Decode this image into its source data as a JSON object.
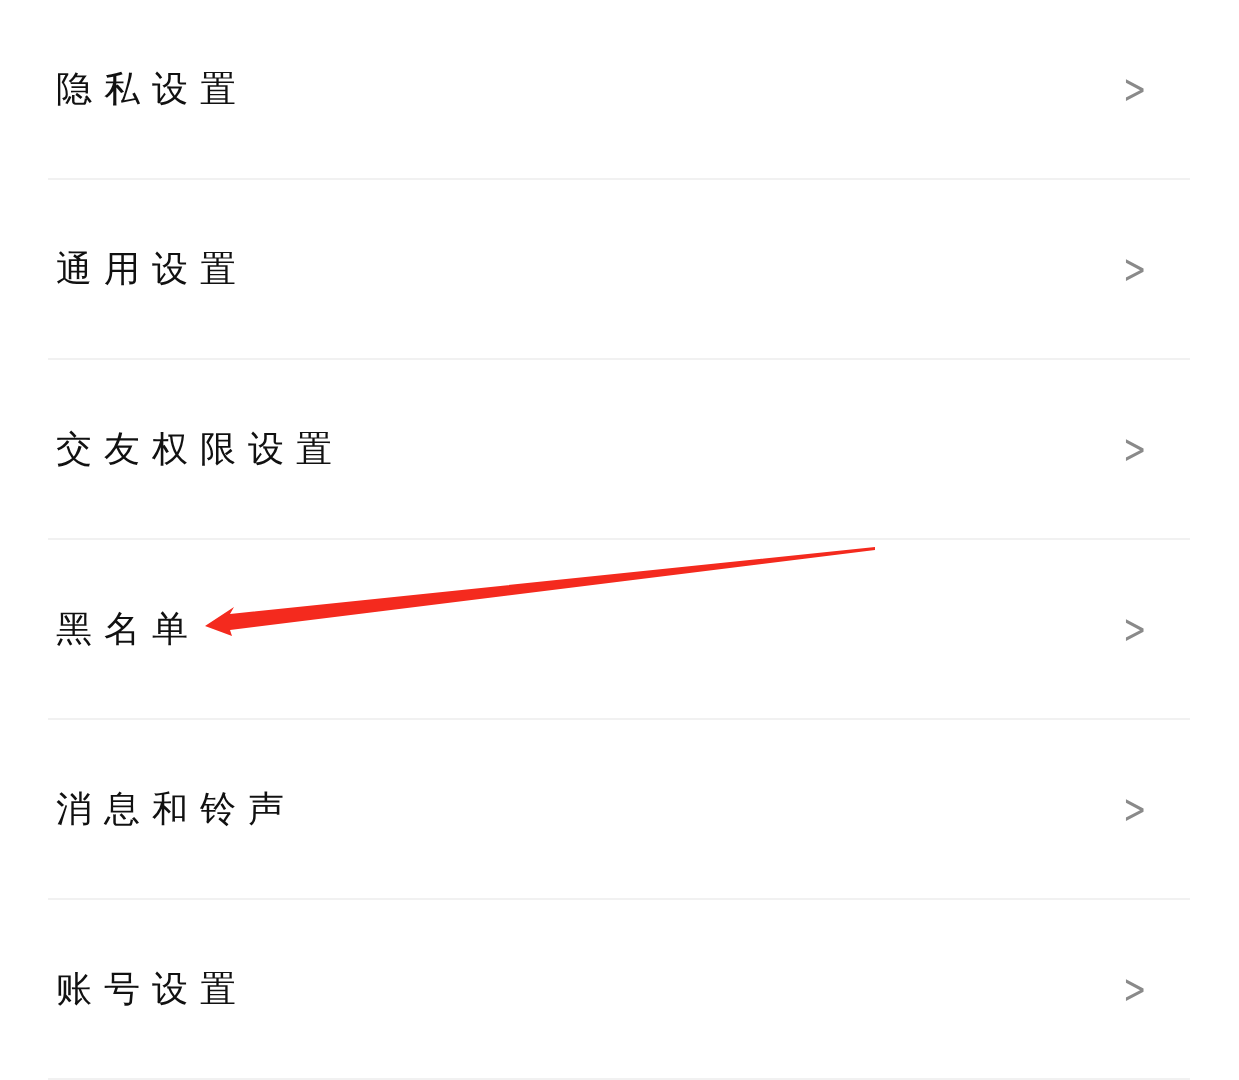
{
  "settings_list": [
    {
      "label": "隐私设置",
      "chevron": ">"
    },
    {
      "label": "通用设置",
      "chevron": ">"
    },
    {
      "label": "交友权限设置",
      "chevron": ">"
    },
    {
      "label": "黑名单",
      "chevron": ">"
    },
    {
      "label": "消息和铃声",
      "chevron": ">"
    },
    {
      "label": "账号设置",
      "chevron": ">"
    }
  ]
}
